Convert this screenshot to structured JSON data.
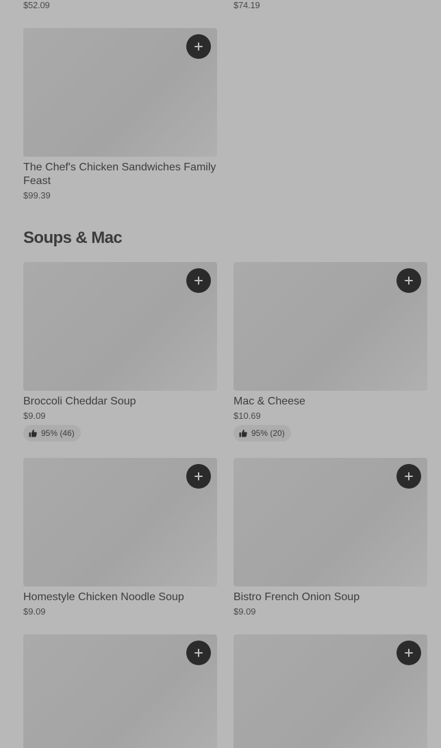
{
  "top_prices": [
    "$52.09",
    "$74.19"
  ],
  "family_feast": {
    "title": "The Chef's Chicken Sandwiches Family Feast",
    "price": "$99.39"
  },
  "section": {
    "title": "Soups & Mac"
  },
  "items": [
    {
      "title": "Broccoli Cheddar Soup",
      "price": "$9.09",
      "rating": "95% (46)"
    },
    {
      "title": "Mac & Cheese",
      "price": "$10.69",
      "rating": "95% (20)"
    },
    {
      "title": "Homestyle Chicken Noodle Soup",
      "price": "$9.09"
    },
    {
      "title": "Bistro French Onion Soup",
      "price": "$9.09"
    }
  ],
  "icons": {
    "add": "plus-icon",
    "rating": "thumbs-up-icon"
  },
  "colors": {
    "button_bg": "#2b2b2b",
    "overlay_bg": "#b8b8b8"
  }
}
